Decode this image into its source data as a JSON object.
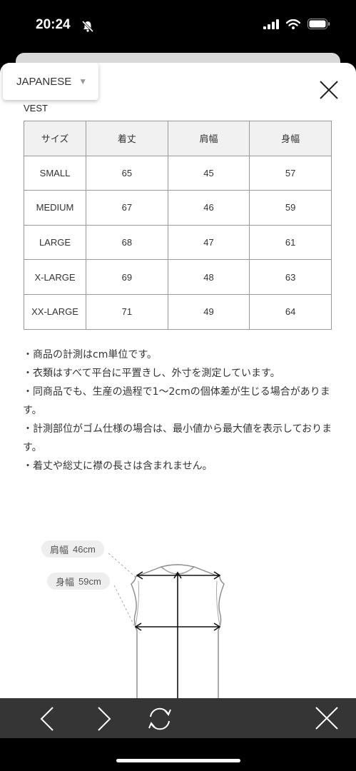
{
  "status": {
    "time": "20:24"
  },
  "lang": {
    "label": "JAPANESE"
  },
  "section_title": "VEST",
  "table": {
    "headers": [
      "サイズ",
      "着丈",
      "肩幅",
      "身幅"
    ],
    "rows": [
      [
        "SMALL",
        "65",
        "45",
        "57"
      ],
      [
        "MEDIUM",
        "67",
        "46",
        "59"
      ],
      [
        "LARGE",
        "68",
        "47",
        "61"
      ],
      [
        "X-LARGE",
        "69",
        "48",
        "63"
      ],
      [
        "XX-LARGE",
        "71",
        "49",
        "64"
      ]
    ]
  },
  "notes": [
    "・商品の計測はcm単位です。",
    "・衣類はすべて平台に平置きし、外寸を測定しています。",
    "・同商品でも、生産の過程で1〜2cmの個体差が生じる場合があります。",
    "・計測部位がゴム仕様の場合は、最小値から最大値を表示しております。",
    "・着丈や総丈に襟の長さは含まれません。"
  ],
  "diagram": {
    "shoulder_label": "肩幅",
    "shoulder_value": "46cm",
    "width_label": "身幅",
    "width_value": "59cm"
  },
  "icons": {
    "close": "close-icon",
    "back": "chevron-left-icon",
    "forward": "chevron-right-icon",
    "refresh": "refresh-icon"
  }
}
